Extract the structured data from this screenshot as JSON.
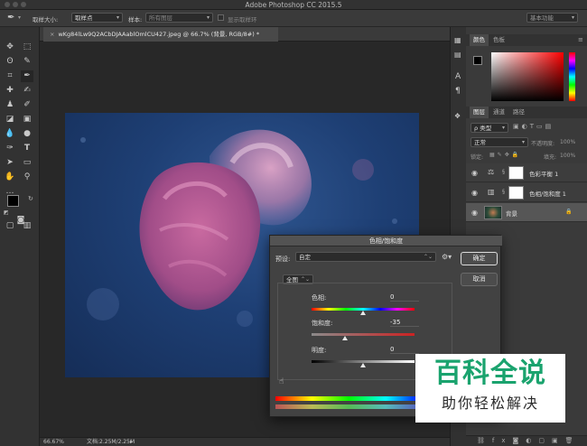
{
  "window": {
    "title": "Adobe Photoshop CC 2015.5"
  },
  "options_bar": {
    "sample_size_label": "取样大小:",
    "sample_size_value": "取样点",
    "sample_label": "样本:",
    "sample_value": "所有图层",
    "show_ring_label": "显示取样环",
    "workspace_value": "基本功能"
  },
  "document": {
    "tab_title": "wKg84lLw9Q2ACbDJAAablOmlCU427.jpeg @ 66.7% (背景, RGB/8#) *",
    "tab_close": "×",
    "status_zoom": "66.67%",
    "status_doc": "文档:2.25M/2.25M"
  },
  "panels": {
    "color_tabs": [
      "颜色",
      "色板"
    ],
    "layers_tabs": [
      "图层",
      "通道",
      "路径"
    ],
    "filter_kind": "ρ 类型",
    "blend_mode": "正常",
    "opacity_label": "不透明度:",
    "opacity_value": "100%",
    "lock_label": "锁定:",
    "fill_label": "填充:",
    "fill_value": "100%",
    "layers": [
      {
        "name": "色彩平衡 1",
        "type": "adjustment"
      },
      {
        "name": "色相/饱和度 1",
        "type": "adjustment"
      },
      {
        "name": "背景",
        "type": "image"
      }
    ]
  },
  "dialog": {
    "title": "色相/饱和度",
    "preset_label": "预设:",
    "preset_value": "自定",
    "ok_label": "确定",
    "cancel_label": "取消",
    "range_value": "全图",
    "hue_label": "色相:",
    "hue_value": "0",
    "saturation_label": "饱和度:",
    "saturation_value": "-35",
    "lightness_label": "明度:",
    "lightness_value": "0"
  },
  "adjustments": {
    "hue": 0,
    "saturation": -35,
    "lightness": 0
  },
  "watermark": {
    "main": "百科全说",
    "sub": "助你轻松解决"
  },
  "colors": {
    "watermark_green": "#1aa36e",
    "foreground": "#000000",
    "background": "#ffffff"
  }
}
